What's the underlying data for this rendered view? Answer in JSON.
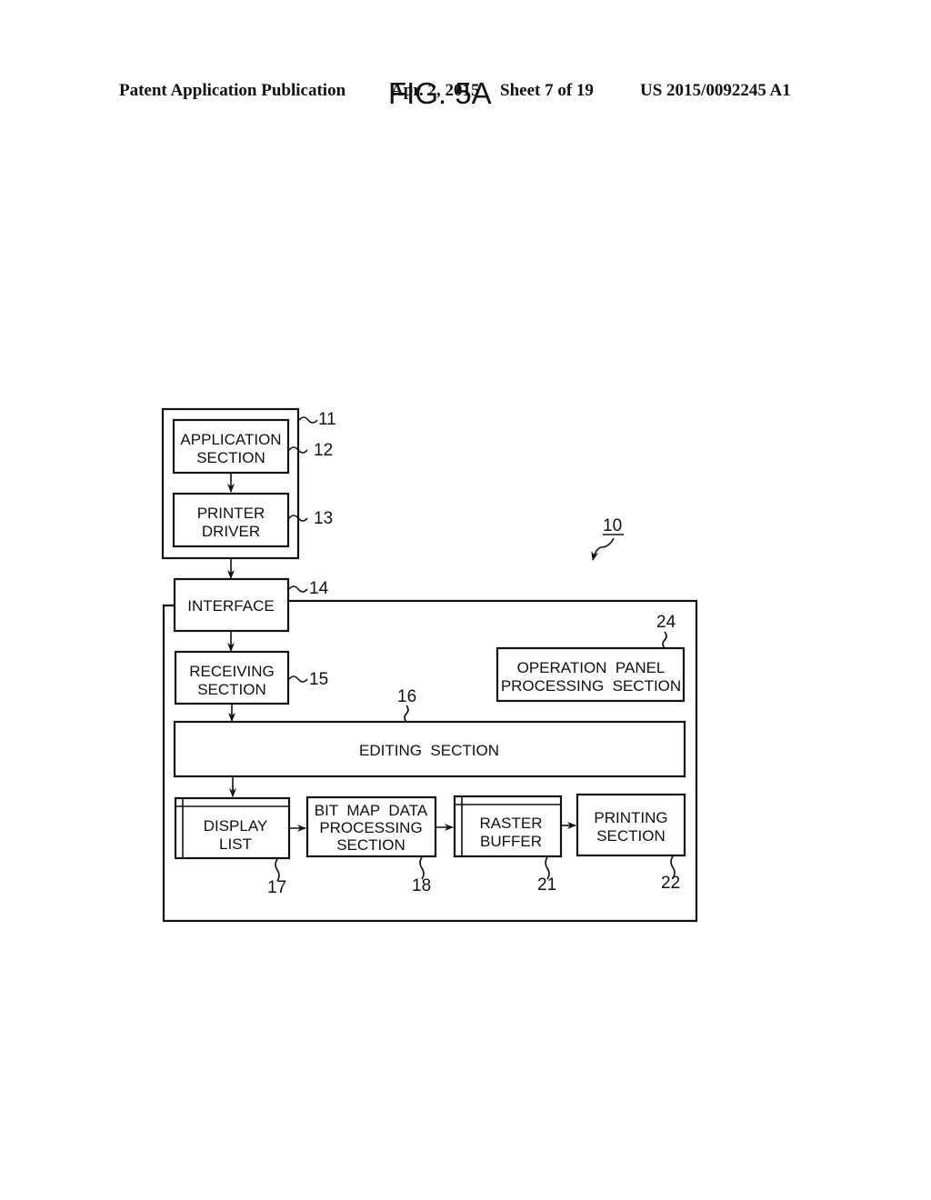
{
  "header": {
    "publication": "Patent Application Publication",
    "date": "Apr. 2, 2015",
    "sheet": "Sheet 7 of 19",
    "patent_number": "US 2015/0092245 A1"
  },
  "figure": {
    "title": "FIG. 5A",
    "system_ref": "10",
    "host_ref": "11",
    "blocks": {
      "application": {
        "line1": "APPLICATION",
        "line2": "SECTION",
        "ref": "12"
      },
      "printer_driver": {
        "line1": "PRINTER",
        "line2": "DRIVER",
        "ref": "13"
      },
      "interface": {
        "line1": "INTERFACE",
        "ref": "14"
      },
      "receiving": {
        "line1": "RECEIVING",
        "line2": "SECTION",
        "ref": "15"
      },
      "editing": {
        "line1": "EDITING  SECTION",
        "ref": "16"
      },
      "display_list": {
        "line1": "DISPLAY",
        "line2": "LIST",
        "ref": "17"
      },
      "bitmap": {
        "line1": "BIT  MAP  DATA",
        "line2": "PROCESSING",
        "line3": "SECTION",
        "ref": "18"
      },
      "raster_buffer": {
        "line1": "RASTER",
        "line2": "BUFFER",
        "ref": "21"
      },
      "printing": {
        "line1": "PRINTING",
        "line2": "SECTION",
        "ref": "22"
      },
      "operation_panel": {
        "line1": "OPERATION  PANEL",
        "line2": "PROCESSING  SECTION",
        "ref": "24"
      }
    }
  }
}
